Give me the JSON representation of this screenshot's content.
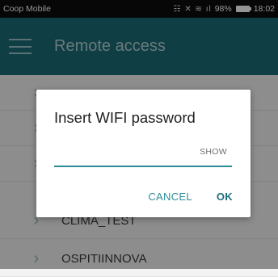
{
  "status_bar": {
    "carrier": "Coop Mobile",
    "signal_text": "98%",
    "time": "18:02"
  },
  "app_bar": {
    "title": "Remote access",
    "menu_icon": "hamburger-menu-icon"
  },
  "list": {
    "items": [
      {
        "label": ""
      },
      {
        "label": ""
      },
      {
        "label": ""
      },
      {
        "label": "CLIMA_TEST"
      },
      {
        "label": "OSPITIINNOVA"
      }
    ]
  },
  "dialog": {
    "title": "Insert WIFI password",
    "password_value": "",
    "show_label": "SHOW",
    "cancel_label": "CANCEL",
    "ok_label": "OK"
  },
  "colors": {
    "appbar": "#1a6b76",
    "accent": "#2a8a96",
    "overlay": "rgba(0,0,0,0.42)"
  }
}
